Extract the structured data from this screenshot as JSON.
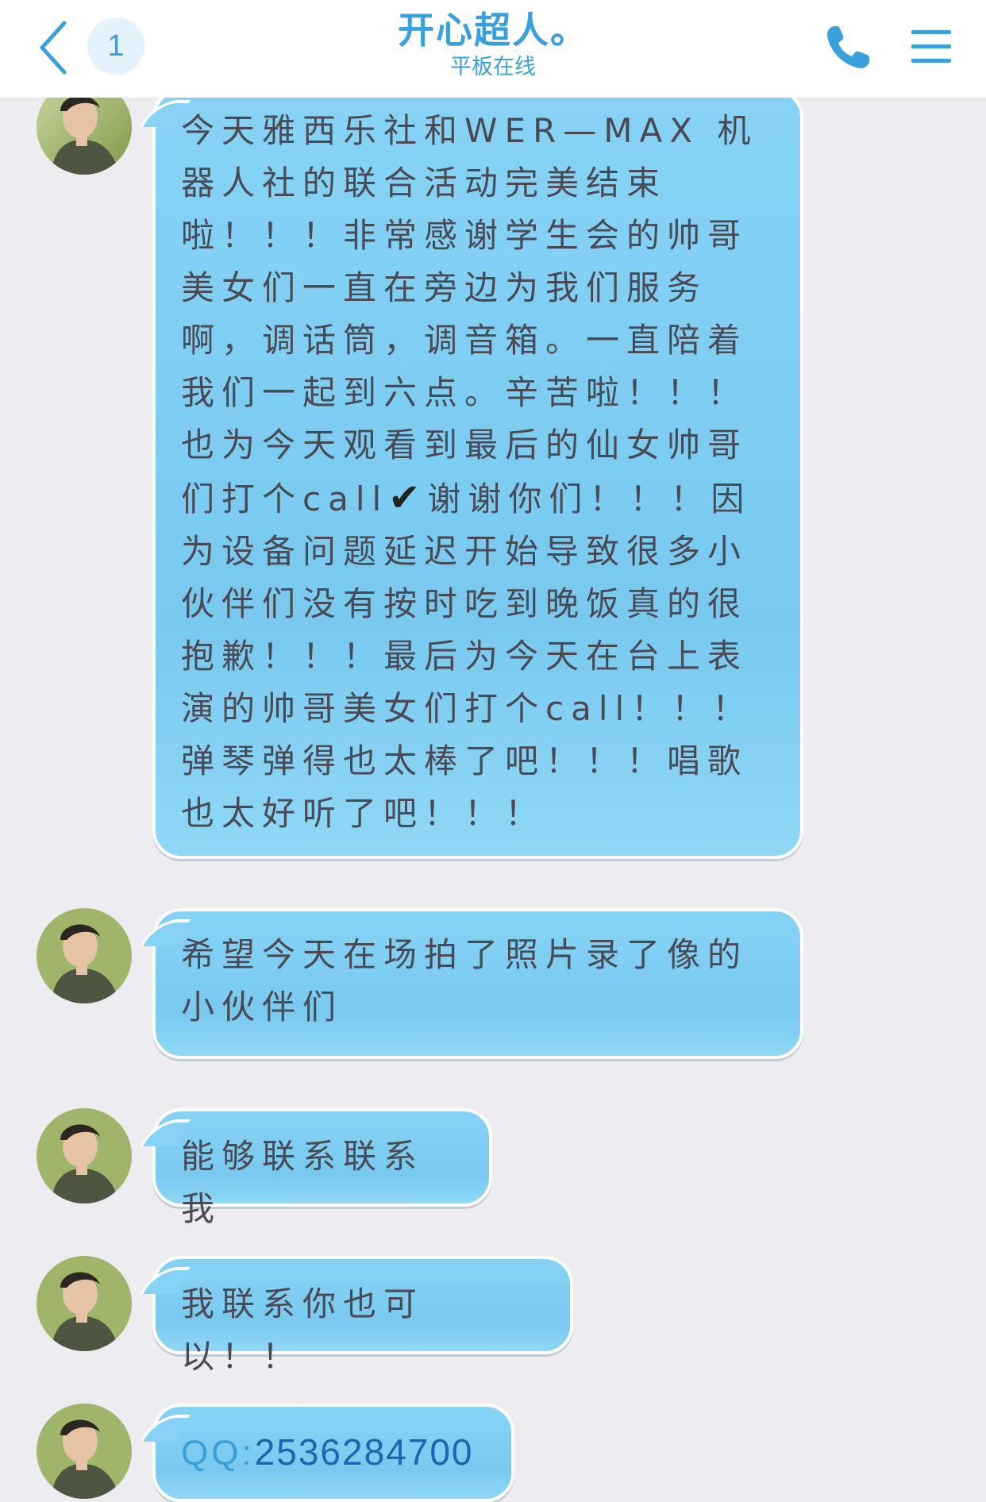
{
  "header": {
    "back_icon": "chevron-left-icon",
    "unread_count": "1",
    "title": "开心超人。",
    "subtitle": "平板在线",
    "call_icon": "phone-icon",
    "menu_icon": "menu-icon"
  },
  "colors": {
    "accent": "#3aa0dc",
    "bubble": "#86d3f5",
    "background": "#ececf1",
    "link": "#1e63b4"
  },
  "messages": [
    {
      "sender_avatar": "contact-avatar",
      "text_before_check": "今天雅西乐社和WER—MAX 机器人社的联合活动完美结束啦！！！非常感谢学生会的帅哥美女们一直在旁边为我们服务啊，调话筒，调音箱。一直陪着我们一起到六点。辛苦啦！！！也为今天观看到最后的仙女帅哥们打个call",
      "check_icon": "✔",
      "text_after_check": "谢谢你们！！！因为设备问题延迟开始导致很多小伙伴们没有按时吃到晚饭真的很抱歉！！！最后为今天在台上表演的帅哥美女们打个call！！！弹琴弹得也太棒了吧！！！唱歌也太好听了吧！！！"
    },
    {
      "sender_avatar": "contact-avatar",
      "text": "希望今天在场拍了照片录了像的小伙伴们"
    },
    {
      "sender_avatar": "contact-avatar",
      "text": "能够联系联系我"
    },
    {
      "sender_avatar": "contact-avatar",
      "text": "我联系你也可以！！"
    },
    {
      "sender_avatar": "contact-avatar",
      "qq_prefix": "QQ:",
      "qq_number": "2536284700"
    }
  ]
}
